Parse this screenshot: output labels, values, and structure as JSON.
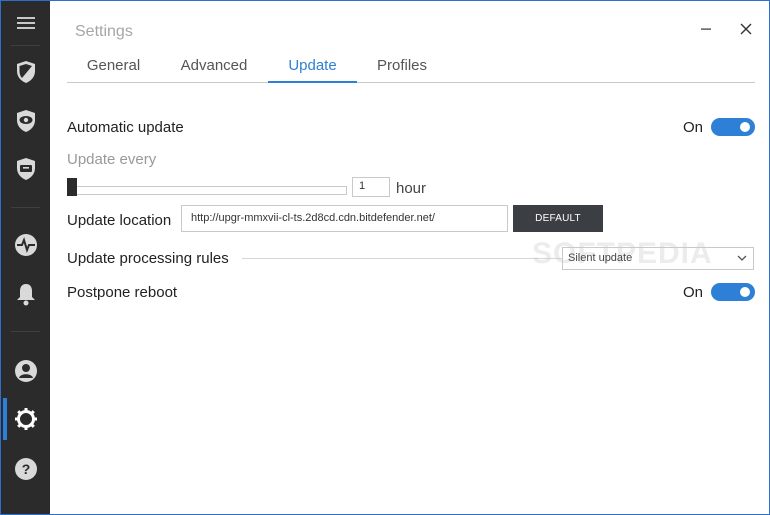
{
  "window": {
    "title": "Settings",
    "accent": "#2e80d6"
  },
  "sidebar": {
    "items": [
      {
        "icon": "menu-icon"
      },
      {
        "icon": "shield-icon"
      },
      {
        "icon": "eye-shield-icon"
      },
      {
        "icon": "tv-shield-icon"
      },
      {
        "icon": "activity-icon"
      },
      {
        "icon": "bell-icon"
      },
      {
        "icon": "user-icon"
      },
      {
        "icon": "gear-icon",
        "active": true
      },
      {
        "icon": "help-icon"
      }
    ]
  },
  "tabs": [
    {
      "label": "General"
    },
    {
      "label": "Advanced"
    },
    {
      "label": "Update",
      "active": true
    },
    {
      "label": "Profiles"
    }
  ],
  "settings": {
    "automatic_update": {
      "label": "Automatic update",
      "state": "On"
    },
    "update_every": {
      "label": "Update every",
      "value": "1",
      "unit": "hour",
      "slider_fraction": 0.0
    },
    "update_location": {
      "label": "Update location",
      "url": "http://upgr-mmxvii-cl-ts.2d8cd.cdn.bitdefender.net/",
      "button": "DEFAULT"
    },
    "update_processing_rules": {
      "label": "Update processing rules",
      "selected": "Silent update"
    },
    "postpone_reboot": {
      "label": "Postpone reboot",
      "state": "On"
    }
  },
  "watermark": "SOFTPEDIA"
}
